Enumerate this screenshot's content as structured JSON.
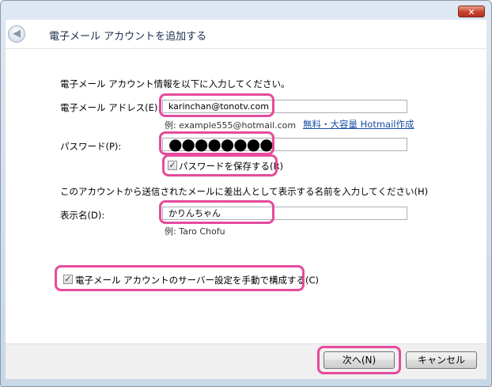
{
  "window": {
    "close_glyph": "✕"
  },
  "header": {
    "title": "電子メール アカウントを追加する",
    "back_glyph": "◀"
  },
  "form": {
    "intro": "電子メール アカウント情報を以下に入力してください。",
    "email_label": "電子メール アドレス(E):",
    "email_value": "karinchan@tonotv.com",
    "email_example": "例: example555@hotmail.com",
    "hotmail_link": "無料・大容量 Hotmail作成",
    "password_label": "パスワード(P):",
    "password_mask": "●●●●●●●●",
    "save_password_label": "パスワードを保存する(R)",
    "save_password_checked": true,
    "display_name_instruction": "このアカウントから送信されたメールに差出人として表示する名前を入力してください(H)",
    "display_name_label": "表示名(D):",
    "display_name_value": "かりんちゃん",
    "display_name_example": "例: Taro Chofu",
    "manual_config_label": "電子メール アカウントのサーバー設定を手動で構成する(C)",
    "manual_config_checked": true
  },
  "footer": {
    "next_label": "次へ(N)",
    "cancel_label": "キャンセル"
  },
  "colors": {
    "highlight": "#e64b9c",
    "link": "#1a4fa8"
  }
}
